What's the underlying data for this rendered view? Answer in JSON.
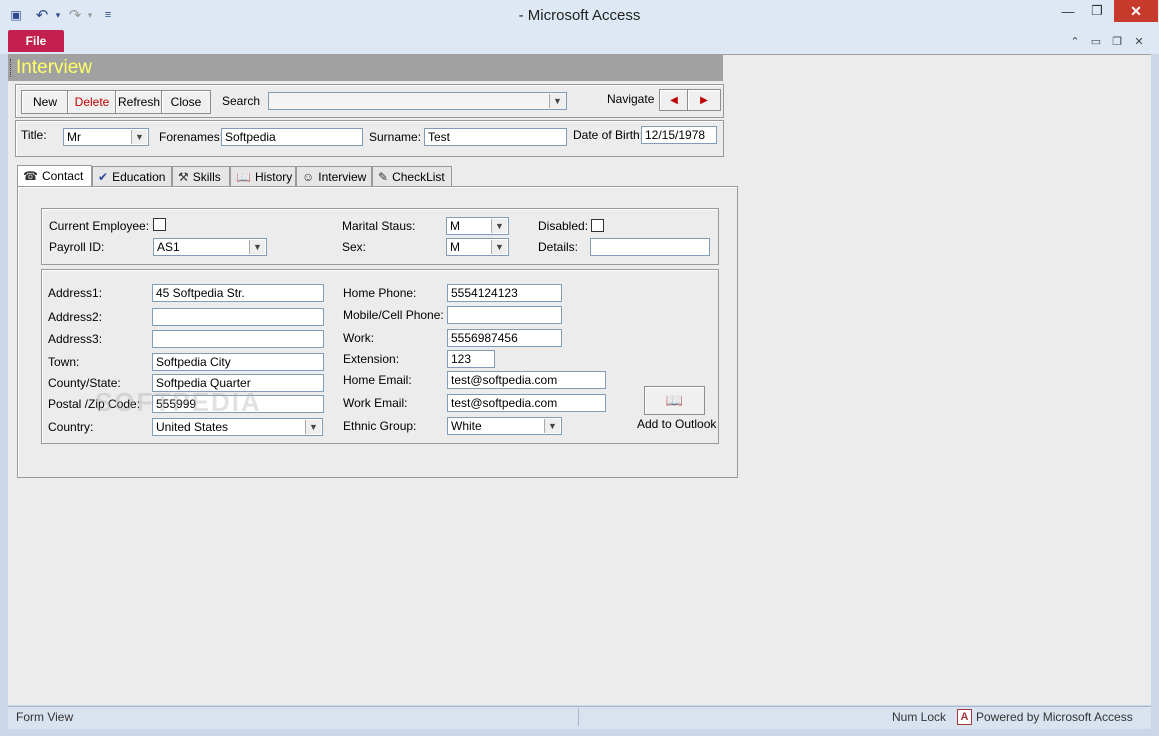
{
  "window": {
    "title": "-  Microsoft Access",
    "minimize_glyph": "—",
    "restore_glyph": "❐",
    "close_glyph": "✕"
  },
  "ribbon": {
    "file_tab": "File",
    "glyphs": {
      "undo": "↶",
      "redo": "↷",
      "dropdown": "▾",
      "customize": "≡",
      "collapse": "⌃",
      "mini": "▭",
      "restore": "❐",
      "close": "✕",
      "app": "▣"
    }
  },
  "form": {
    "title": "Interview",
    "toolbar": {
      "new_label": "New",
      "delete_label": "Delete",
      "refresh_label": "Refresh",
      "close_label": "Close",
      "search_label": "Search",
      "search_value": "",
      "navigate_label": "Navigate",
      "prev_glyph": "◀",
      "next_glyph": "▶"
    },
    "person": {
      "title_label": "Title:",
      "title_value": "Mr",
      "forenames_label": "Forenames:",
      "forenames_value": "Softpedia",
      "surname_label": "Surname:",
      "surname_value": "Test",
      "dob_label": "Date of Birth:",
      "dob_value": "12/15/1978"
    },
    "tabs": [
      {
        "label": "Contact",
        "icon": "☎",
        "active": true
      },
      {
        "label": "Education",
        "icon": "✔",
        "active": false
      },
      {
        "label": "Skills",
        "icon": "⚒",
        "active": false
      },
      {
        "label": "History",
        "icon": "📖",
        "active": false
      },
      {
        "label": "Interview",
        "icon": "☺",
        "active": false
      },
      {
        "label": "CheckList",
        "icon": "✎",
        "active": false
      }
    ],
    "employment": {
      "current_employee_label": "Current Employee:",
      "current_employee_checked": false,
      "payroll_label": "Payroll ID:",
      "payroll_value": "AS1",
      "marital_label": "Marital Staus:",
      "marital_value": "M",
      "sex_label": "Sex:",
      "sex_value": "M",
      "disabled_label": "Disabled:",
      "disabled_checked": false,
      "details_label": "Details:",
      "details_value": ""
    },
    "address": {
      "address1_label": "Address1:",
      "address1_value": "45 Softpedia Str.",
      "address2_label": "Address2:",
      "address2_value": "",
      "address3_label": "Address3:",
      "address3_value": "",
      "town_label": "Town:",
      "town_value": "Softpedia City",
      "county_label": "County/State:",
      "county_value": "Softpedia Quarter",
      "postal_label": "Postal /Zip Code:",
      "postal_value": "555999",
      "country_label": "Country:",
      "country_value": "United States"
    },
    "phones": {
      "home_phone_label": "Home Phone:",
      "home_phone_value": "5554124123",
      "mobile_label": "Mobile/Cell Phone:",
      "mobile_value": "",
      "work_label": "Work:",
      "work_value": "5556987456",
      "extension_label": "Extension:",
      "extension_value": "123",
      "home_email_label": "Home Email:",
      "home_email_value": "test@softpedia.com",
      "work_email_label": "Work Email:",
      "work_email_value": "test@softpedia.com",
      "ethnic_label": "Ethnic Group:",
      "ethnic_value": "White"
    },
    "outlook": {
      "icon": "📖",
      "label": "Add to Outlook"
    }
  },
  "watermark": "SOFTPEDIA",
  "statusbar": {
    "view": "Form View",
    "numlock": "Num Lock",
    "logo_letter": "A",
    "powered": "Powered by Microsoft Access"
  }
}
